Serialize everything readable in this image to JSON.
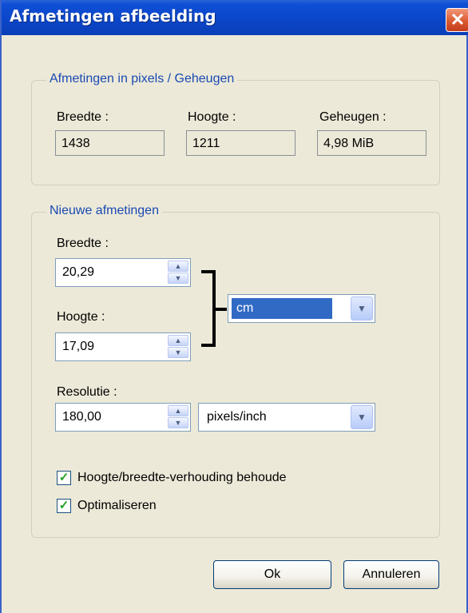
{
  "window": {
    "title": "Afmetingen afbeelding"
  },
  "pixels_group": {
    "legend": "Afmetingen in pixels / Geheugen",
    "width_label": "Breedte :",
    "width_value": "1438",
    "height_label": "Hoogte :",
    "height_value": "1211",
    "memory_label": "Geheugen :",
    "memory_value": "4,98 MiB"
  },
  "new_group": {
    "legend": "Nieuwe afmetingen",
    "width_label": "Breedte :",
    "width_value": "20,29",
    "height_label": "Hoogte :",
    "height_value": "17,09",
    "unit_value": "cm",
    "resolution_label": "Resolutie :",
    "resolution_value": "180,00",
    "resolution_unit": "pixels/inch",
    "keep_ratio_label": "Hoogte/breedte-verhouding behoude",
    "keep_ratio_checked": true,
    "optimize_label": "Optimaliseren",
    "optimize_checked": true
  },
  "buttons": {
    "ok": "Ok",
    "cancel": "Annuleren"
  }
}
